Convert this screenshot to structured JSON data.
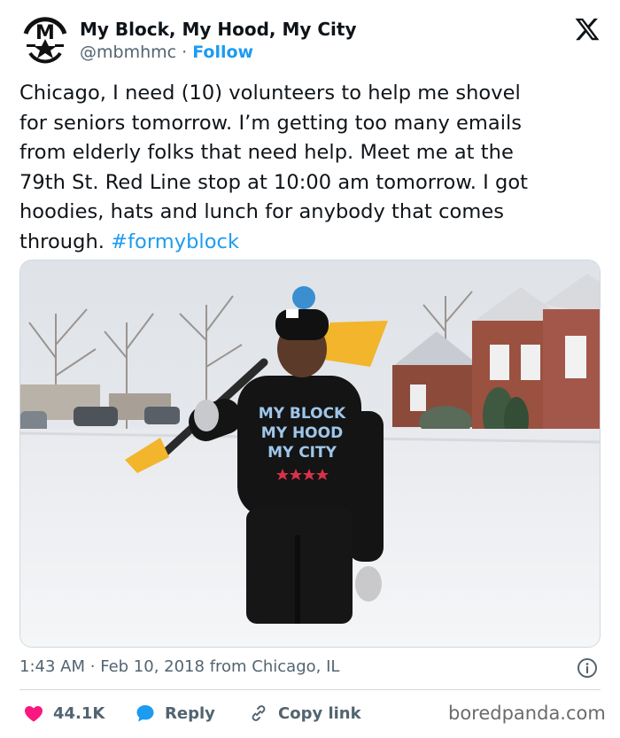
{
  "author": {
    "display_name": "My Block, My Hood, My City",
    "handle": "@mbmhmc",
    "separator": "·",
    "follow_label": "Follow",
    "avatar_logo_text": "MY BLOCK MY HOOD MY CITY"
  },
  "tweet": {
    "text": "Chicago, I need (10) volunteers to help me shovel\nfor seniors tomorrow. I’m getting too many emails\nfrom elderly folks that need help. Meet me at the\n79th St. Red Line stop at 10:00 am tomorrow. I got\nhoodies, hats and lunch for anybody that comes\nthrough. ",
    "hashtag": "#formyblock"
  },
  "media": {
    "description": "Man in a black MY BLOCK MY HOOD MY CITY hoodie holding a yellow snow shovel on a snowy residential street",
    "hoodie_text": [
      "MY BLOCK",
      "MY HOOD",
      "MY CITY"
    ]
  },
  "meta": {
    "time": "1:43 AM",
    "separator": "·",
    "date": "Feb 10, 2018",
    "source": "from Chicago, IL"
  },
  "actions": {
    "likes": "44.1K",
    "reply_label": "Reply",
    "copy_link_label": "Copy link"
  },
  "watermark": "boredpanda.com",
  "colors": {
    "accent_blue": "#1d9bf0",
    "like_red": "#f91880",
    "text_primary": "#0f1419",
    "text_secondary": "#536471"
  },
  "icons": [
    "x-logo-icon",
    "info-icon",
    "heart-icon",
    "reply-bubble-icon",
    "link-icon"
  ]
}
